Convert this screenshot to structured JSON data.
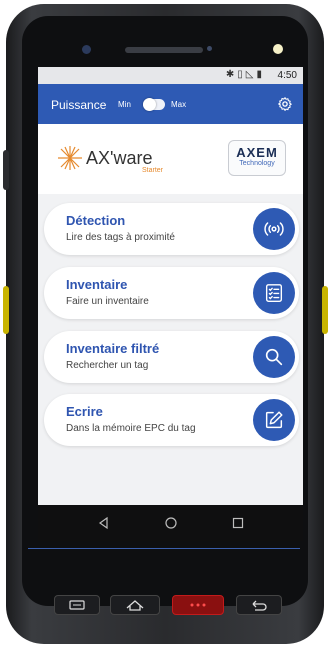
{
  "status_bar": {
    "time": "4:50",
    "icons": [
      "bluetooth-icon",
      "vibrate-icon",
      "signal-icon",
      "battery-icon"
    ]
  },
  "app_bar": {
    "title": "Puissance",
    "toggle_min": "Min",
    "toggle_max": "Max",
    "settings_icon": "gear-icon"
  },
  "logos": {
    "brand_name": "AX'ware",
    "brand_sub": "Starter",
    "partner_line1": "AXEM",
    "partner_line2": "Technology"
  },
  "menu": [
    {
      "title": "Détection",
      "subtitle": "Lire des tags à proximité",
      "icon": "radar-icon"
    },
    {
      "title": "Inventaire",
      "subtitle": "Faire un inventaire",
      "icon": "checklist-icon"
    },
    {
      "title": "Inventaire filtré",
      "subtitle": "Rechercher un tag",
      "icon": "search-icon"
    },
    {
      "title": "Ecrire",
      "subtitle": "Dans la mémoire EPC du tag",
      "icon": "edit-icon"
    }
  ],
  "colors": {
    "accent": "#2e5ab4",
    "title_blue": "#2f55b0",
    "brand_orange": "#e68a2e",
    "background": "#f1f2f4"
  }
}
